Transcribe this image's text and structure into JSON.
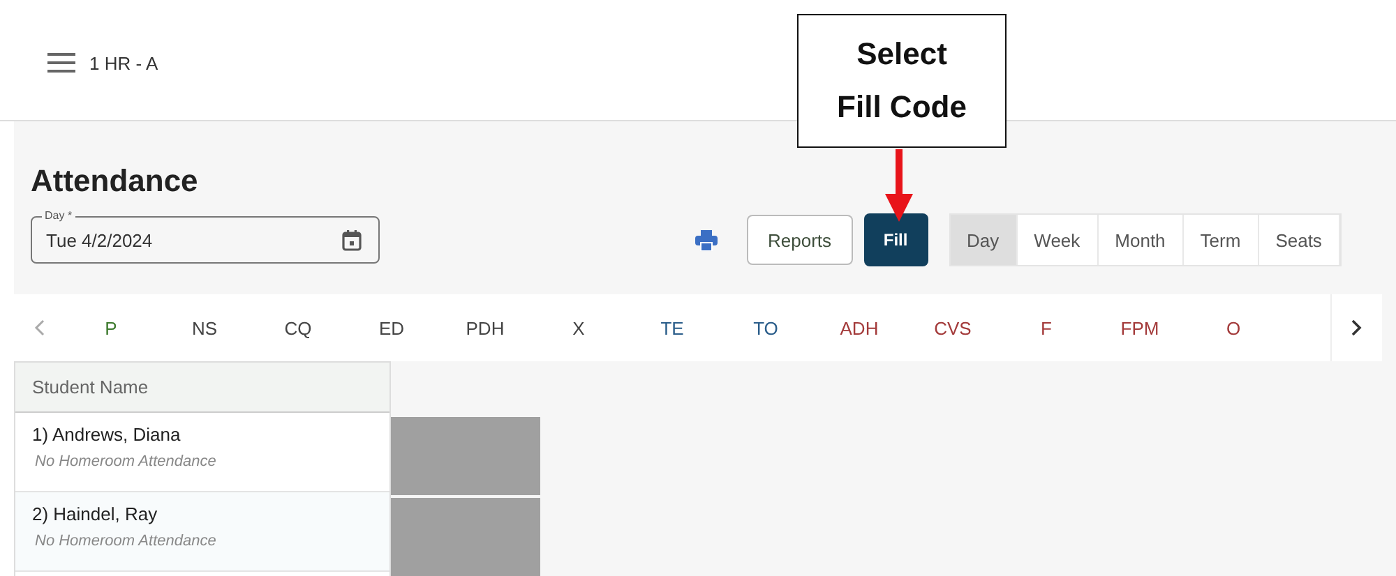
{
  "header": {
    "title": "1 HR - A"
  },
  "page_title": "Attendance",
  "day_field": {
    "label": "Day *",
    "value": "Tue 4/2/2024"
  },
  "buttons": {
    "reports": "Reports",
    "fill": "Fill"
  },
  "view_tabs": [
    {
      "label": "Day",
      "selected": true
    },
    {
      "label": "Week",
      "selected": false
    },
    {
      "label": "Month",
      "selected": false
    },
    {
      "label": "Term",
      "selected": false
    },
    {
      "label": "Seats",
      "selected": false
    }
  ],
  "codes": [
    {
      "label": "P",
      "color": "#3d7a2e"
    },
    {
      "label": "NS",
      "color": "#444444"
    },
    {
      "label": "CQ",
      "color": "#444444"
    },
    {
      "label": "ED",
      "color": "#444444"
    },
    {
      "label": "PDH",
      "color": "#444444"
    },
    {
      "label": "X",
      "color": "#444444"
    },
    {
      "label": "TE",
      "color": "#2a5d8a"
    },
    {
      "label": "TO",
      "color": "#2a5d8a"
    },
    {
      "label": "ADH",
      "color": "#a33a3a"
    },
    {
      "label": "CVS",
      "color": "#a33a3a"
    },
    {
      "label": "F",
      "color": "#a33a3a"
    },
    {
      "label": "FPM",
      "color": "#a33a3a"
    },
    {
      "label": "O",
      "color": "#a33a3a"
    }
  ],
  "table": {
    "column": "Student Name",
    "rows": [
      {
        "name": "1) Andrews, Diana",
        "note": "No Homeroom Attendance"
      },
      {
        "name": "2) Haindel, Ray",
        "note": "No Homeroom Attendance"
      }
    ]
  },
  "callout": {
    "line_1": "Select",
    "line_2": "Fill Code"
  }
}
